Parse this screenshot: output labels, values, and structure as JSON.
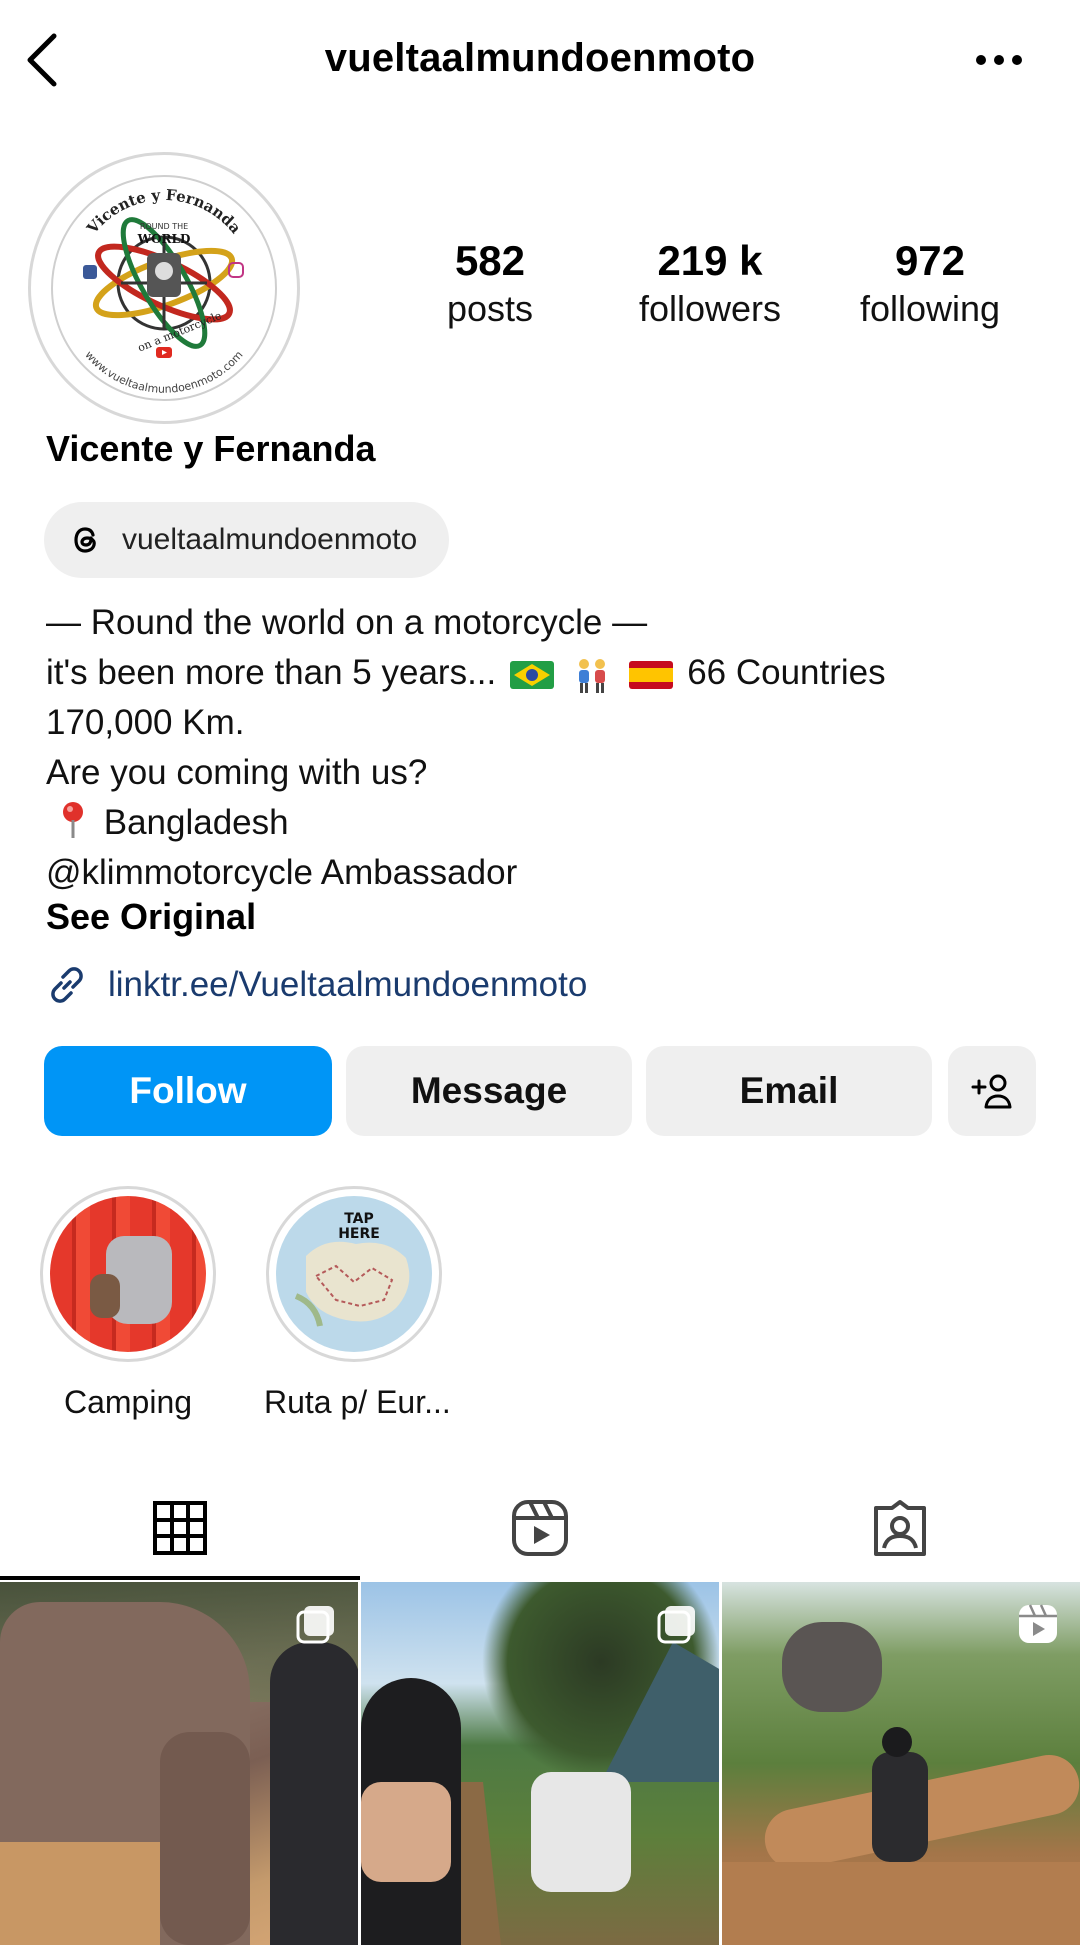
{
  "header": {
    "username": "vueltaalmundoenmoto"
  },
  "avatar": {
    "ring_top_text": "Vicente y Fernanda",
    "center_small": "ROUND THE",
    "center_big": "WORLD",
    "motto": "on a motorcycle",
    "ring_bottom_text": "www.vueltaalmundoenmoto.com"
  },
  "stats": {
    "posts": {
      "value": "582",
      "label": "posts"
    },
    "followers": {
      "value": "219 k",
      "label": "followers"
    },
    "following": {
      "value": "972",
      "label": "following"
    }
  },
  "profile": {
    "display_name": "Vicente y Fernanda",
    "threads_handle": "vueltaalmundoenmoto",
    "bio": {
      "line1": "— Round the world on a motorcycle —",
      "line2_prefix": "it's been more than 5 years... ",
      "line2_suffix": " 66 Countries",
      "line3": "170,000 Km.",
      "line4": "Are you coming with us?",
      "line5": "Bangladesh",
      "line6": " @klimmotorcycle Ambassador"
    },
    "see_original": "See Original",
    "link": "linktr.ee/Vueltaalmundoenmoto"
  },
  "actions": {
    "follow": "Follow",
    "message": "Message",
    "email": "Email"
  },
  "highlights": [
    {
      "label": "Camping"
    },
    {
      "label": "Ruta p/ Eur...",
      "cover_text": "TAP HERE"
    }
  ],
  "colors": {
    "follow_blue": "#0095f6",
    "link_blue": "#1a3b6e",
    "chip_bg": "#efefef"
  },
  "icons": {
    "back": "chevron-left-icon",
    "more": "more-horizontal-icon",
    "threads": "threads-logo-icon",
    "link": "link-icon",
    "add_person": "add-person-icon",
    "grid": "grid-icon",
    "reels": "reels-icon",
    "tagged": "tagged-icon"
  }
}
